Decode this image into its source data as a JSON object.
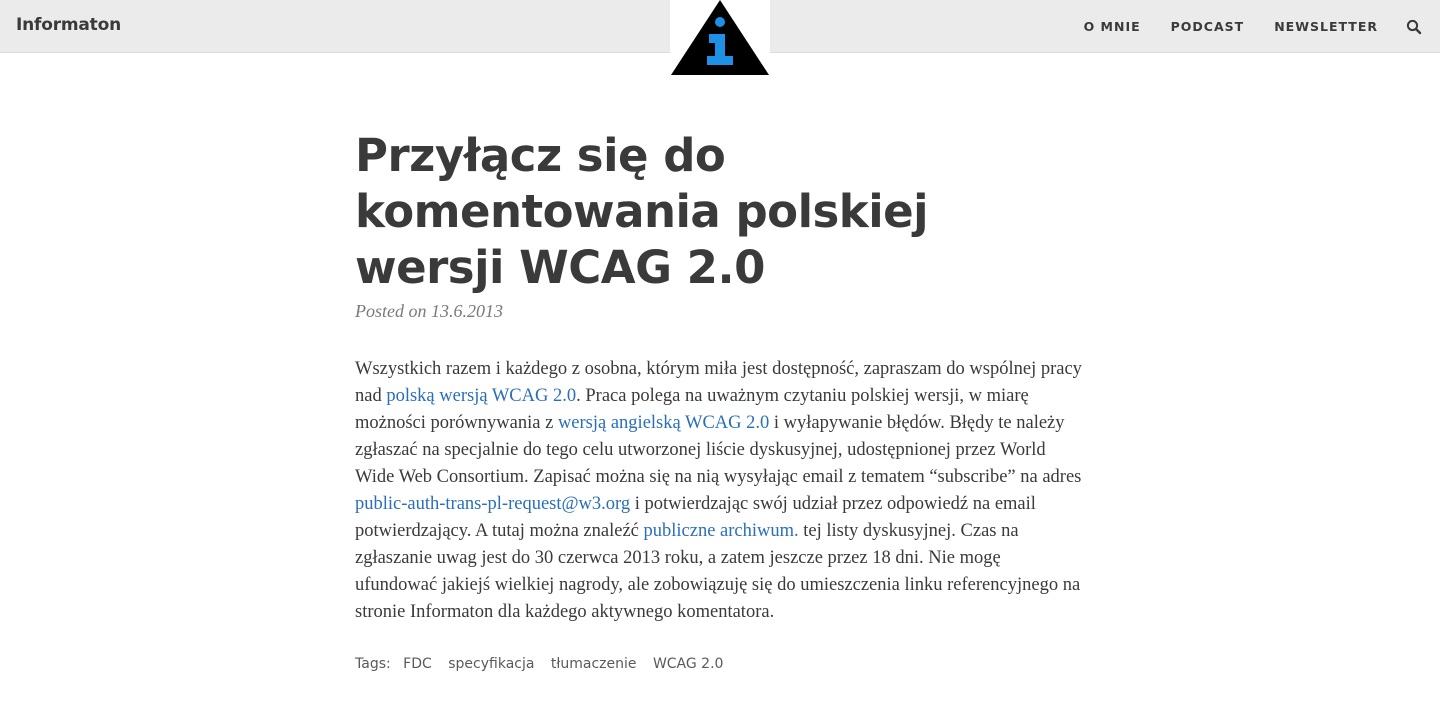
{
  "header": {
    "site_title": "Informaton",
    "logo_letter": "i",
    "nav": [
      {
        "label": "O MNIE"
      },
      {
        "label": "PODCAST"
      },
      {
        "label": "NEWSLETTER"
      }
    ],
    "search_icon": "search-icon"
  },
  "post": {
    "title": "Przyłącz się do komentowania polskiej wersji WCAG 2.0",
    "meta": "Posted on 13.6.2013",
    "body": [
      {
        "type": "text",
        "value": "Wszystkich razem i każdego z osobna, którym miła jest dostępność, zapraszam do wspólnej pracy nad "
      },
      {
        "type": "link",
        "value": "polską wersją WCAG 2.0"
      },
      {
        "type": "text",
        "value": ". Praca polega na uważnym czytaniu polskiej wersji, w miarę możności porównywania z "
      },
      {
        "type": "link",
        "value": "wersją angielską WCAG 2.0"
      },
      {
        "type": "text",
        "value": " i wyłapywanie błędów. Błędy te należy zgłaszać na specjalnie do tego celu utworzonej liście dyskusyjnej, udostępnionej przez World Wide Web Consortium. Zapisać można się na nią wysyłając email z tematem “subscribe” na adres "
      },
      {
        "type": "link",
        "value": "public-auth-trans-pl-request@w3.org"
      },
      {
        "type": "text",
        "value": " i potwierdzając swój udział przez odpowiedź na email potwierdzający. A tutaj można znaleźć "
      },
      {
        "type": "link",
        "value": "publiczne archiwum."
      },
      {
        "type": "text",
        "value": " tej listy dyskusyjnej. Czas na zgłaszanie uwag jest do 30 czerwca 2013 roku, a zatem jeszcze przez 18 dni. Nie mogę ufundować jakiejś wielkiej nagrody, ale zobowiązuję się do umieszczenia linku referencyjnego na stronie Informaton dla każdego aktywnego komentatora."
      }
    ],
    "tags_label": "Tags:",
    "tags": [
      "FDC",
      "specyfikacja",
      "tłumaczenie",
      "WCAG 2.0"
    ]
  },
  "colors": {
    "header_bg": "#ebebeb",
    "text": "#3a3a3a",
    "link": "#2a6ebb",
    "logo_triangle": "#000000",
    "logo_letter": "#1e90e6"
  }
}
